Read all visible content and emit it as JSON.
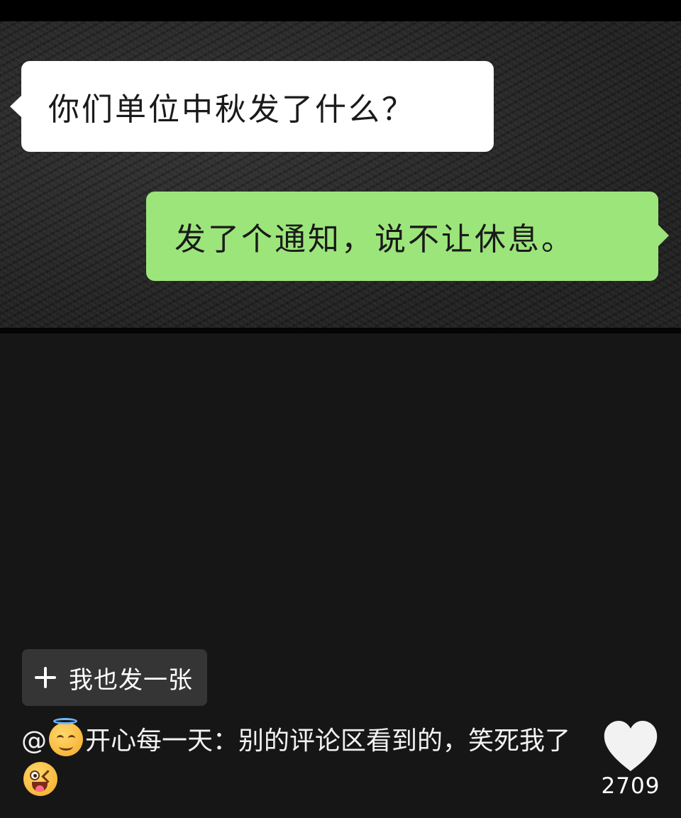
{
  "chat_image": {
    "incoming_message": "你们单位中秋发了什么？",
    "outgoing_message": "发了个通知，说不让休息。",
    "outgoing_bubble_color": "#9ce57b",
    "incoming_bubble_color": "#ffffff"
  },
  "post_button": {
    "label": "我也发一张",
    "icon": "plus-icon"
  },
  "caption": {
    "mention_prefix": "@",
    "author_emoji": "smiling-face-with-halo",
    "author": "开心每一天",
    "text": "：别的评论区看到的，笑死我了",
    "trailing_emoji": "winking-face-with-tongue"
  },
  "like": {
    "icon": "heart-icon",
    "count": "2709"
  }
}
